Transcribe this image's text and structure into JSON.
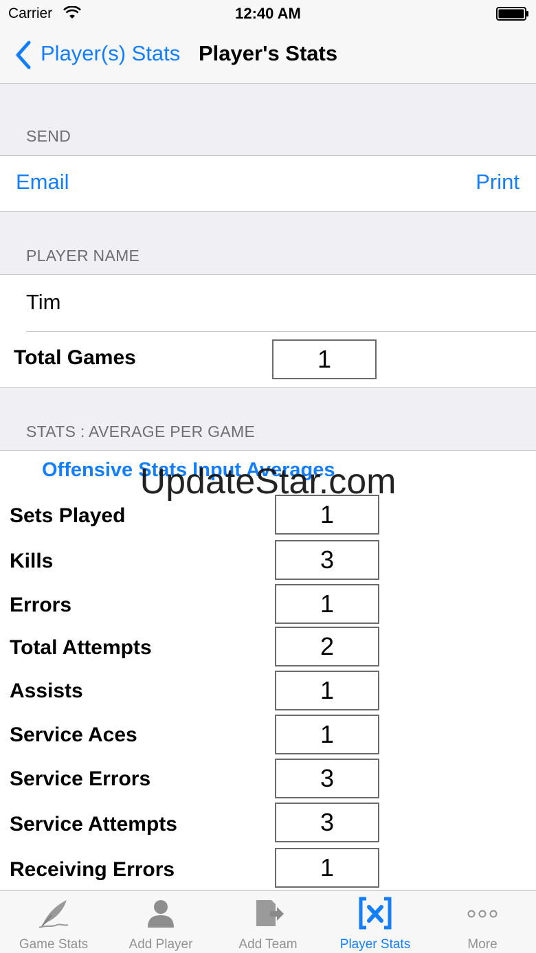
{
  "status_bar": {
    "carrier": "Carrier",
    "time": "12:40 AM"
  },
  "nav": {
    "back_label": "Player(s) Stats",
    "title": "Player's Stats"
  },
  "send": {
    "header": "SEND",
    "email_label": "Email",
    "print_label": "Print"
  },
  "player": {
    "header": "PLAYER NAME",
    "name": "Tim",
    "total_games_label": "Total Games",
    "total_games_value": "1"
  },
  "stats": {
    "header": "STATS : AVERAGE PER GAME",
    "section_title": "Offensive Stats Input Averages",
    "rows": [
      {
        "label": "Sets Played",
        "value": "1"
      },
      {
        "label": "Kills",
        "value": "3"
      },
      {
        "label": "Errors",
        "value": "1"
      },
      {
        "label": "Total Attempts",
        "value": "2"
      },
      {
        "label": "Assists",
        "value": "1"
      },
      {
        "label": "Service Aces",
        "value": "1"
      },
      {
        "label": "Service Errors",
        "value": "3"
      },
      {
        "label": "Service Attempts",
        "value": "3"
      },
      {
        "label": "Receiving Errors",
        "value": "1"
      }
    ]
  },
  "watermark": "UpdateStar.com",
  "tabs": [
    {
      "label": "Game Stats",
      "icon": "quill-icon"
    },
    {
      "label": "Add Player",
      "icon": "person-icon"
    },
    {
      "label": "Add Team",
      "icon": "add-team-icon"
    },
    {
      "label": "Player Stats",
      "icon": "bracket-x-icon",
      "active": true
    },
    {
      "label": "More",
      "icon": "more-dots-icon"
    }
  ],
  "colors": {
    "accent": "#147efb",
    "inactive_tab": "#929292",
    "group_bg": "#efeff4"
  }
}
